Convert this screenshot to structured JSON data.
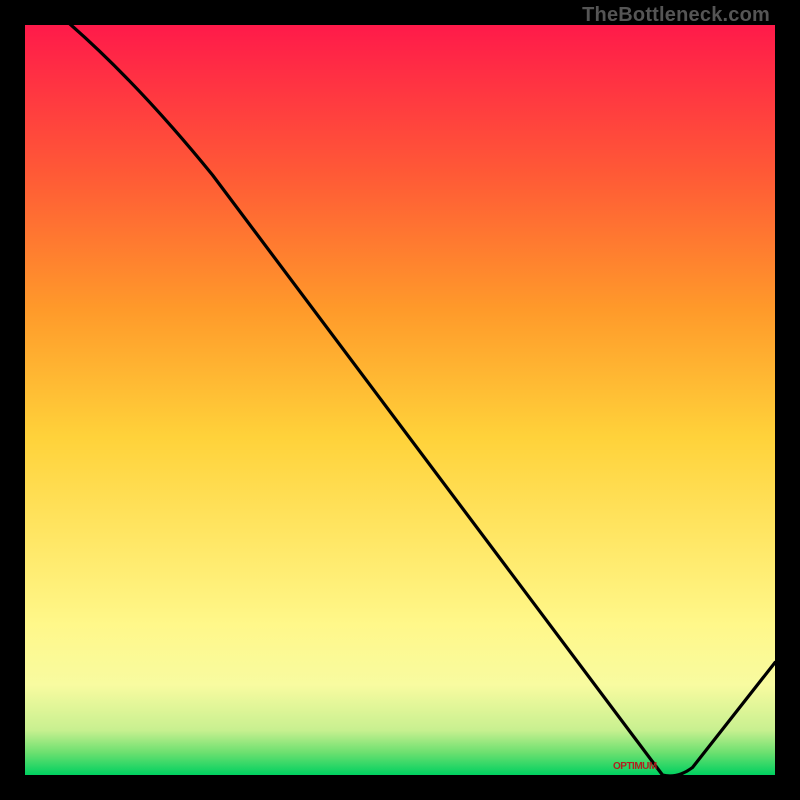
{
  "watermark": "TheBottleneck.com",
  "marker_label": "OPTIMUM",
  "chart_data": {
    "type": "line",
    "title": "",
    "xlabel": "",
    "ylabel": "",
    "xlim": [
      0,
      100
    ],
    "ylim": [
      0,
      100
    ],
    "grid": false,
    "legend": false,
    "x": [
      0,
      25,
      85,
      100
    ],
    "values": [
      105,
      80,
      0,
      15
    ],
    "optimum_x": 85,
    "optimum_y": 0,
    "background_gradient": {
      "stops": [
        {
          "pos": 0.0,
          "color": "#00d060"
        },
        {
          "pos": 0.03,
          "color": "#6de070"
        },
        {
          "pos": 0.06,
          "color": "#c8f090"
        },
        {
          "pos": 0.12,
          "color": "#f8fba0"
        },
        {
          "pos": 0.2,
          "color": "#fff88a"
        },
        {
          "pos": 0.45,
          "color": "#ffd23a"
        },
        {
          "pos": 0.62,
          "color": "#ff9a2a"
        },
        {
          "pos": 0.8,
          "color": "#ff5a36"
        },
        {
          "pos": 1.0,
          "color": "#ff1a4a"
        }
      ]
    }
  }
}
